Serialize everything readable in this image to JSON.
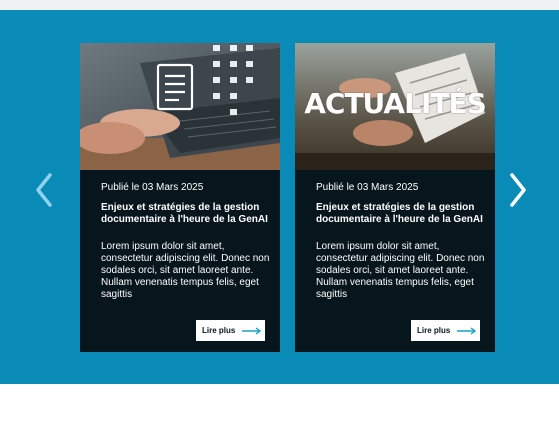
{
  "carousel": {
    "prev_icon": "chevron-left-icon",
    "next_icon": "chevron-right-icon",
    "cards": [
      {
        "image_icon": "laptop-documents-image",
        "date": "Publié le 03 Mars 2025",
        "title": "Enjeux et stratégies de la gestion documentaire à l'heure de la GenAI",
        "excerpt": "Lorem ipsum dolor sit amet, consectetur adipiscing elit. Donec non sodales orci, sit amet laoreet ante. Nullam venenatis tempus felis, eget sagittis",
        "cta": "Lire plus"
      },
      {
        "image_icon": "newspaper-image",
        "image_overlay": "ACTUALITÉS",
        "date": "Publié le 03 Mars 2025",
        "title": "Enjeux et stratégies de la gestion documentaire à l'heure de la GenAI",
        "excerpt": "Lorem ipsum dolor sit amet, consectetur adipiscing elit. Donec non sodales orci, sit amet laoreet ante. Nullam venenatis tempus felis, eget sagittis",
        "cta": "Lire plus"
      }
    ]
  },
  "colors": {
    "section_bg": "#0a8ab6",
    "card_bg": "#07151c",
    "arrow_accent": "#1a9fc9"
  }
}
